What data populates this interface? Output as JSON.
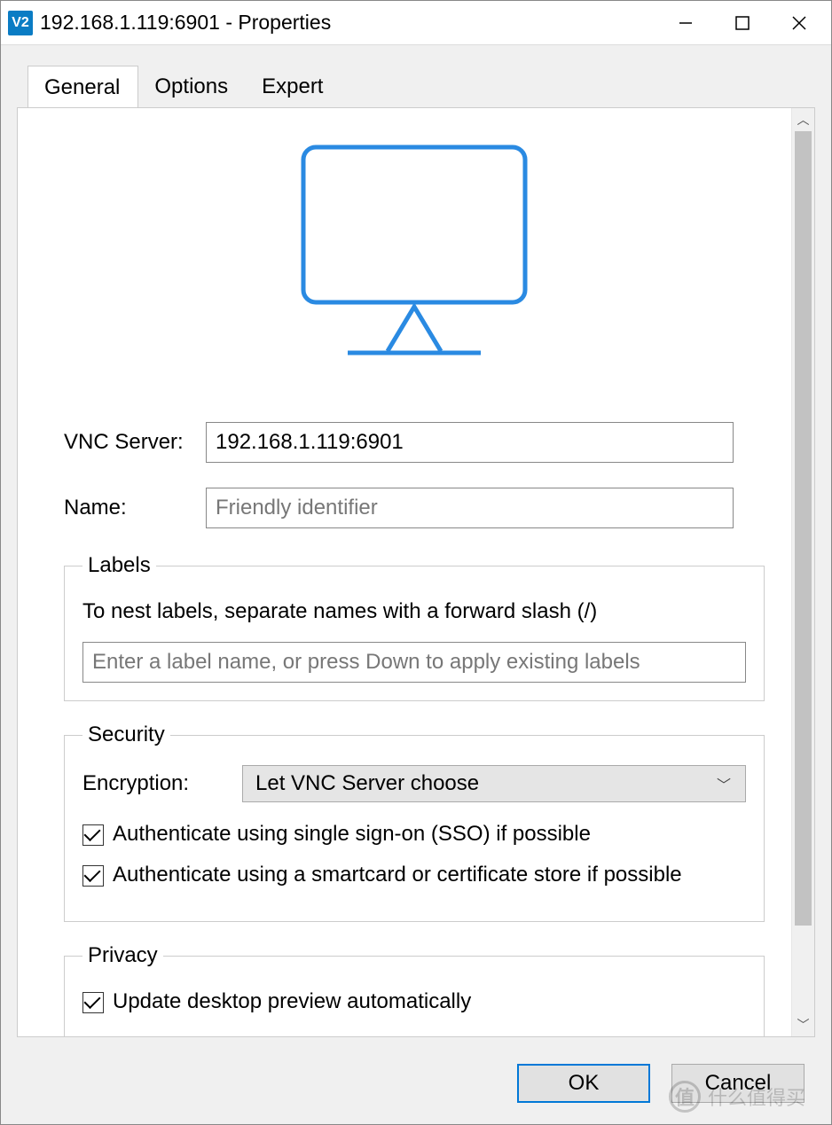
{
  "window": {
    "title": "192.168.1.119:6901 - Properties"
  },
  "tabs": {
    "general": "General",
    "options": "Options",
    "expert": "Expert"
  },
  "general": {
    "vnc_server_label": "VNC Server:",
    "vnc_server_value": "192.168.1.119:6901",
    "name_label": "Name:",
    "name_placeholder": "Friendly identifier"
  },
  "labels_group": {
    "legend": "Labels",
    "hint": "To nest labels, separate names with a forward slash (/)",
    "placeholder": "Enter a label name, or press Down to apply existing labels"
  },
  "security_group": {
    "legend": "Security",
    "encryption_label": "Encryption:",
    "encryption_value": "Let VNC Server choose",
    "sso_label": "Authenticate using single sign-on (SSO) if possible",
    "smartcard_label": "Authenticate using a smartcard or certificate store if possible"
  },
  "privacy_group": {
    "legend": "Privacy",
    "update_preview_label": "Update desktop preview automatically"
  },
  "buttons": {
    "ok": "OK",
    "cancel": "Cancel"
  },
  "watermark": {
    "text": "什么值得买"
  }
}
